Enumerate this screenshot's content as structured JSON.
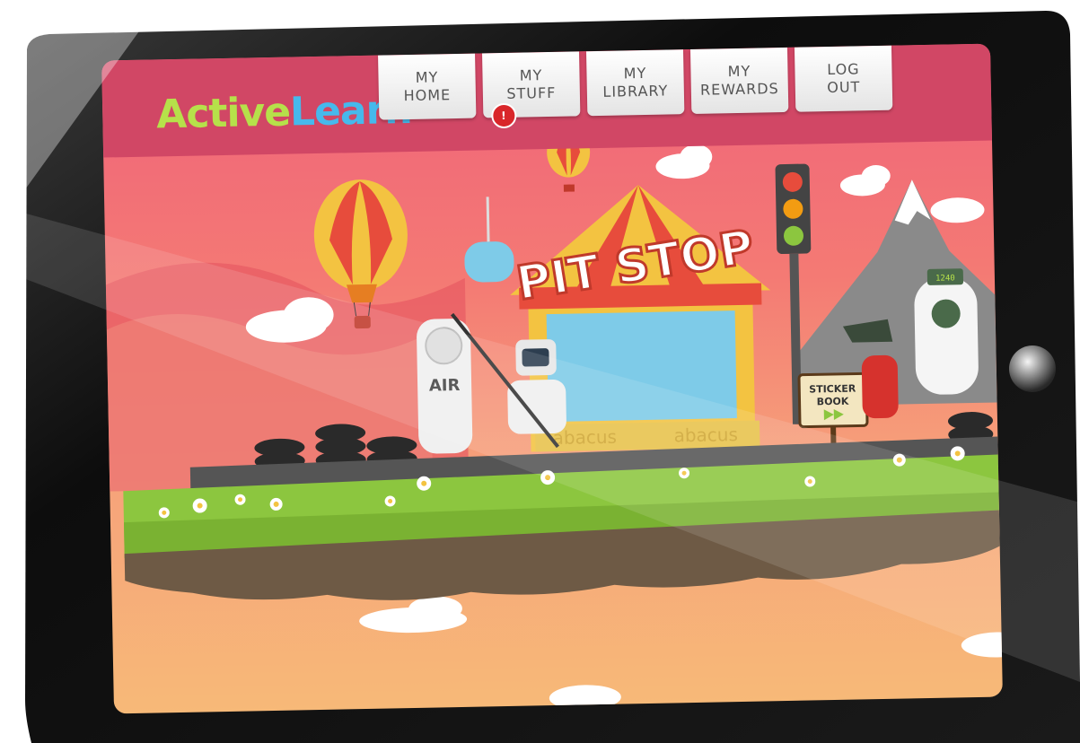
{
  "logo": {
    "part1": "Active",
    "part2": "Learn"
  },
  "nav": {
    "tabs": [
      {
        "label": "MY\nHOME"
      },
      {
        "label": "MY\nSTUFF",
        "badge": "!"
      },
      {
        "label": "MY\nLIBRARY"
      },
      {
        "label": "MY\nREWARDS"
      },
      {
        "label": "LOG\nOUT"
      }
    ]
  },
  "scene": {
    "pit_stop_sign": "PIT STOP",
    "air_label": "AIR",
    "sticker_book_line1": "STICKER",
    "sticker_book_line2": "BOOK",
    "banner_left": "abacus",
    "banner_right": "abacus",
    "charger_display": "1240"
  },
  "colors": {
    "topbar": "#d14765",
    "logo_active": "#b6e14a",
    "logo_learn": "#46b9ec",
    "grass": "#8cc63f",
    "sky_top": "#f0637a",
    "sky_bottom": "#f7b978"
  },
  "icons": {
    "home_button": "circle-button-icon",
    "notification": "alert-badge-icon"
  }
}
